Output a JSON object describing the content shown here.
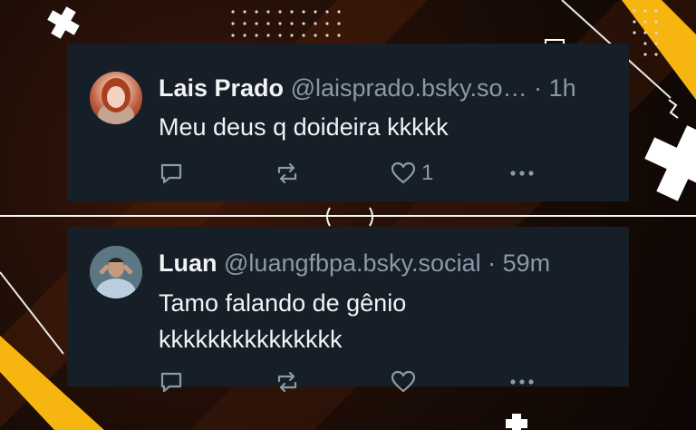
{
  "posts": [
    {
      "name": "Lais Prado",
      "handle": "@laisprado.bsky.so…",
      "time": "· 1h",
      "text": "Meu deus q doideira kkkkk",
      "likes": "1"
    },
    {
      "name": "Luan",
      "handle": "@luangfbpa.bsky.social",
      "time": "· 59m",
      "text": "Tamo falando de gênio kkkkkkkkkkkkkkk",
      "likes": ""
    }
  ],
  "colors": {
    "card_bg": "#161e27",
    "muted_text": "#8c9aa8",
    "accent_yellow": "#f6b60f"
  },
  "icons": [
    "reply-icon",
    "repost-icon",
    "heart-icon",
    "more-icon"
  ]
}
